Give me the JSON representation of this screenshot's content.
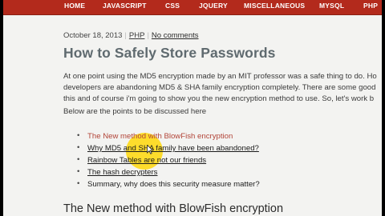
{
  "nav": {
    "items": [
      "HOME",
      "JAVASCRIPT",
      "CSS",
      "JQUERY",
      "MISCELLANEOUS",
      "MYSQL",
      "PHP"
    ]
  },
  "post": {
    "date": "October 18, 2013",
    "category": "PHP",
    "comments": "No comments",
    "title": "How to Safely Store Passwords",
    "paragraph_lines": [
      "At one point using the MD5 encryption made by an MIT professor was a safe thing to do. Ho",
      "developers are abandoning MD5 & SHA family encryption completely. There are some good",
      "this and of course i'm going to show you the new encryption method to use. So, let's work b",
      "Below are the points to be discussed here"
    ],
    "points": [
      "The New method with BlowFish encryption",
      "Why MD5 and SHA family have been abandoned?",
      "Rainbow Tables are not our friends",
      "The hash decrypters",
      "Summary, why does this security measure matter?"
    ],
    "section_heading": "The New method with BlowFish encryption"
  },
  "colors": {
    "nav_bg": "#b32a1c",
    "page_bg": "#f3f3f1",
    "title": "#5f6a6f",
    "active_link": "#b24438",
    "cursor_highlight": "#ffd700"
  }
}
